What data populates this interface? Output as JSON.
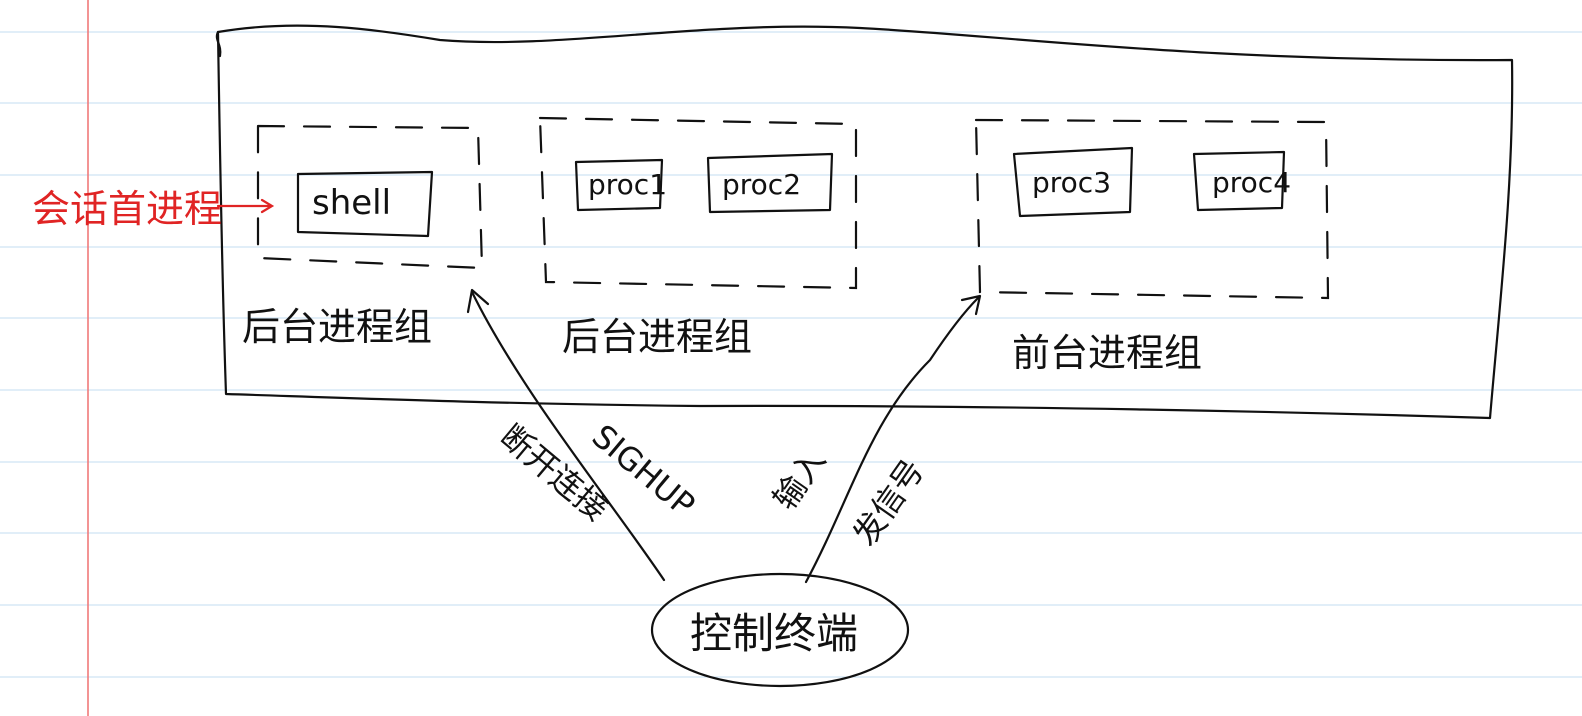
{
  "session_leader_label": "会话首进程",
  "shell_label": "shell",
  "process_groups": [
    {
      "label": "后台进程组",
      "processes": [
        "shell"
      ]
    },
    {
      "label": "后台进程组",
      "processes": [
        "proc1",
        "proc2"
      ]
    },
    {
      "label": "前台进程组",
      "processes": [
        "proc3",
        "proc4"
      ]
    }
  ],
  "proc_labels": [
    "proc1",
    "proc2",
    "proc3",
    "proc4"
  ],
  "group_labels": [
    "后台进程组",
    "后台进程组",
    "前台进程组"
  ],
  "terminal_label": "控制终端",
  "arrow_labels": {
    "disconnect": "断开连接",
    "sighup": "SIGHUP",
    "input": "输入",
    "signal": "发信号"
  },
  "colors": {
    "ink": "#111111",
    "red_ink": "#e02424",
    "ruled_line": "#cfe3f3",
    "margin_line": "#f07a7a"
  }
}
